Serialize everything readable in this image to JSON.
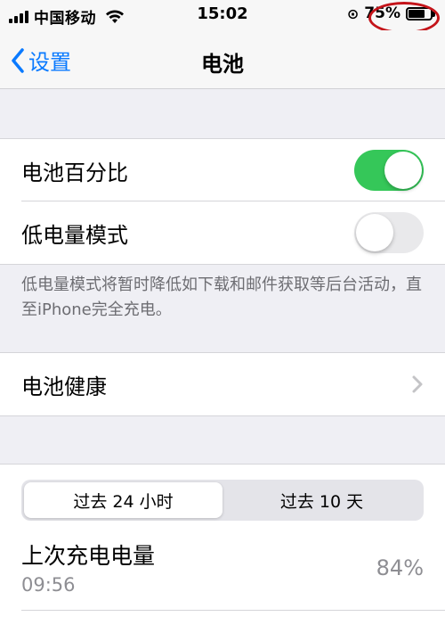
{
  "status_bar": {
    "carrier": "中国移动",
    "time": "15:02",
    "battery_percent": "75%",
    "battery_level": 0.75,
    "icons": [
      "signal-icon",
      "wifi-icon",
      "rotation-lock-icon",
      "battery-icon"
    ]
  },
  "nav": {
    "back_label": "设置",
    "title": "电池"
  },
  "settings": {
    "battery_percentage": {
      "label": "电池百分比",
      "on": true
    },
    "low_power_mode": {
      "label": "低电量模式",
      "on": false
    },
    "footnote": "低电量模式将暂时降低如下载和邮件获取等后台活动，直至iPhone完全充电。",
    "battery_health": {
      "label": "电池健康"
    }
  },
  "usage": {
    "segments": [
      "过去 24 小时",
      "过去 10 天"
    ],
    "selected_segment": 0,
    "last_charge_label": "上次充电电量",
    "last_charge_time": "09:56",
    "last_charge_value": "84%"
  },
  "colors": {
    "accent": "#0a7aff",
    "toggle_on": "#35c759",
    "annotation": "#c4141a"
  }
}
